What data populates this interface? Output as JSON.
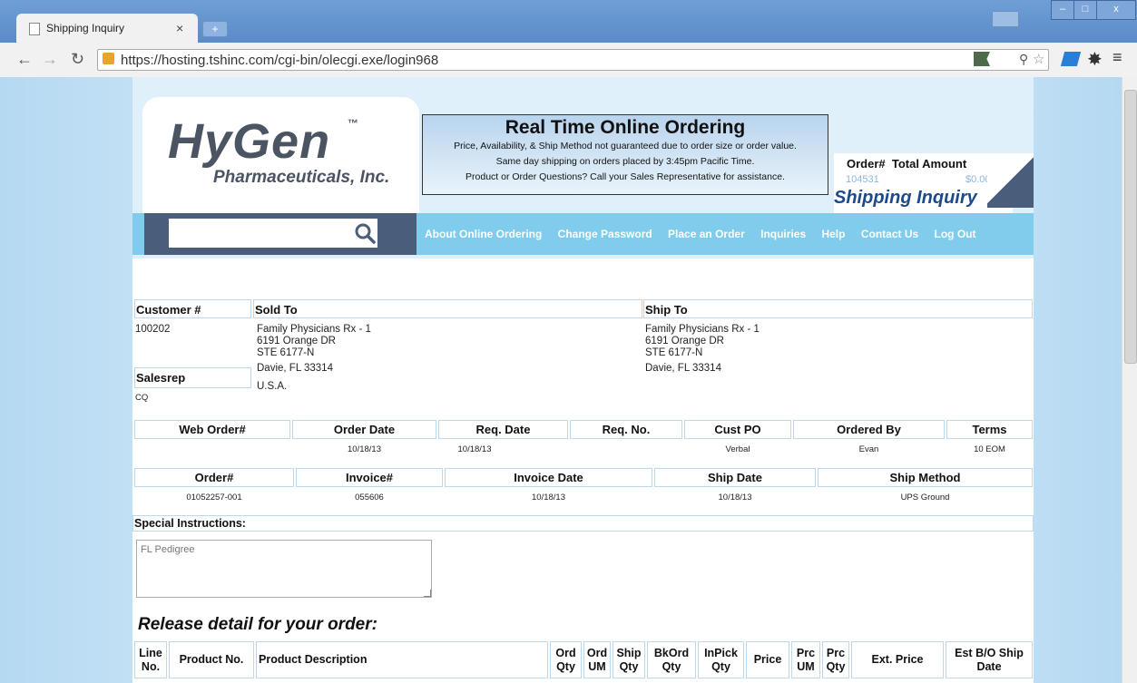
{
  "browser": {
    "tab_title": "Shipping Inquiry",
    "tab_close": "×",
    "new_tab": "+",
    "url_host": "https://hosting.tshinc.com",
    "url_path": "/cgi-bin/olecgi.exe/login968",
    "controls": [
      "–",
      "□",
      "x"
    ]
  },
  "header": {
    "logo_main": "HyGen",
    "logo_tm": "™",
    "logo_sub": "Pharmaceuticals, Inc.",
    "banner_title": "Real Time Online Ordering",
    "banner_lines": [
      "Price, Availability, & Ship Method not guaranteed due to order size or order value.",
      "Same day shipping on orders placed by 3:45pm Pacific Time.",
      "Product or Order Questions?  Call your Sales Representative for assistance."
    ],
    "order_label": "Order#",
    "total_label": "Total Amount",
    "order_number": "104531",
    "total_amount": "$0.00",
    "page_title": "Shipping Inquiry"
  },
  "nav": {
    "search_placeholder": "",
    "links": [
      "About Online Ordering",
      "Change Password",
      "Place an Order",
      "Inquiries",
      "Help",
      "Contact Us",
      "Log Out"
    ]
  },
  "customer": {
    "customer_label": "Customer #",
    "customer_no": "100202",
    "salesrep_label": "Salesrep",
    "salesrep": "CQ",
    "sold_to_label": "Sold To",
    "sold_to": [
      "Family Physicians Rx - 1",
      "6191 Orange DR",
      "STE 6177-N",
      "Davie, FL 33314",
      "U.S.A."
    ],
    "ship_to_label": "Ship To",
    "ship_to": [
      "Family Physicians Rx - 1",
      "6191 Orange DR",
      "STE 6177-N",
      "Davie, FL 33314"
    ]
  },
  "order_info": {
    "headers": [
      "Web Order#",
      "Order Date",
      "Req. Date",
      "Req. No.",
      "Cust PO",
      "Ordered By",
      "Terms"
    ],
    "values": [
      "",
      "10/18/13",
      "10/18/13",
      "",
      "Verbal",
      "Evan",
      "10 EOM"
    ]
  },
  "ship_info": {
    "headers": [
      "Order#",
      "Invoice#",
      "Invoice Date",
      "Ship Date",
      "Ship Method"
    ],
    "values": [
      "01052257-001",
      "055606",
      "10/18/13",
      "10/18/13",
      "UPS Ground"
    ]
  },
  "instructions": {
    "label": "Special Instructions:",
    "text": "FL Pedigree"
  },
  "release": {
    "title": "Release detail for your order:",
    "columns": [
      "Line No.",
      "Product No.",
      "Product Description",
      "Ord Qty",
      "Ord UM",
      "Ship Qty",
      "BkOrd Qty",
      "InPick Qty",
      "Price",
      "Prc UM",
      "Prc Qty",
      "Ext. Price",
      "Est B/O Ship Date"
    ]
  }
}
